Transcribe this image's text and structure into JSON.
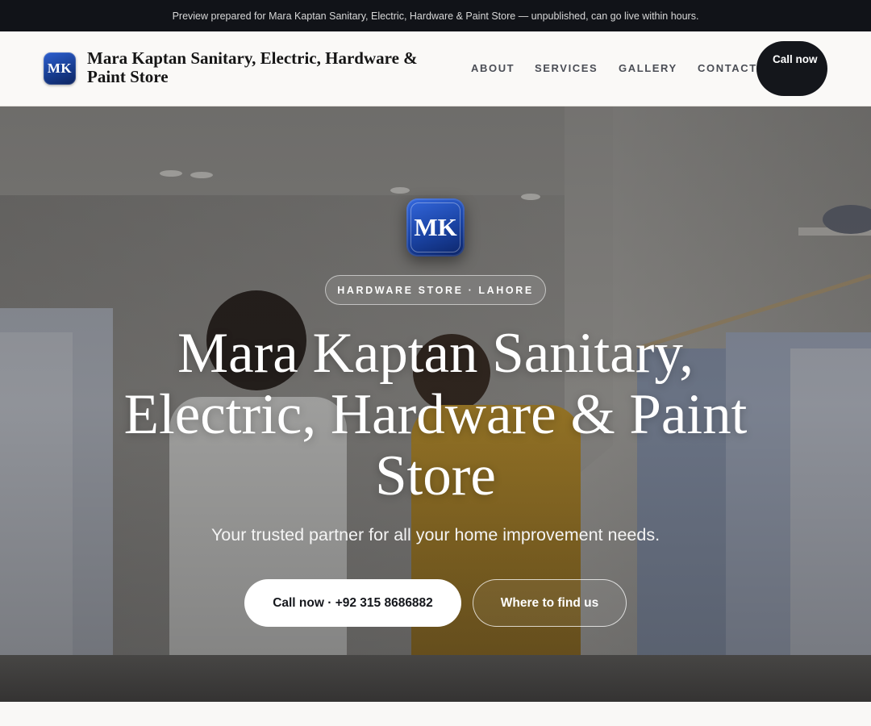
{
  "preview_banner": {
    "text": "Preview prepared for Mara Kaptan Sanitary, Electric, Hardware & Paint Store — unpublished, can go live within hours."
  },
  "header": {
    "logo_initials": "MK",
    "brand_name": "Mara Kaptan Sanitary, Electric, Hardware & Paint Store",
    "nav": [
      {
        "label": "About"
      },
      {
        "label": "Services"
      },
      {
        "label": "Gallery"
      },
      {
        "label": "Contact"
      }
    ],
    "call_button": "Call now"
  },
  "hero": {
    "logo_initials": "MK",
    "eyebrow": "HARDWARE STORE · LAHORE",
    "title": "Mara Kaptan Sanitary, Electric, Hardware & Paint Store",
    "subtitle": "Your trusted partner for all your home improvement needs.",
    "primary_button": "Call now · +92 315 8686882",
    "secondary_button": "Where to find us"
  },
  "colors": {
    "banner_bg": "#111318",
    "header_bg": "#faf9f7",
    "dark_button": "#14161b",
    "logo_blue": "#1a43a3"
  },
  "icons": [
    "mk-logo"
  ]
}
